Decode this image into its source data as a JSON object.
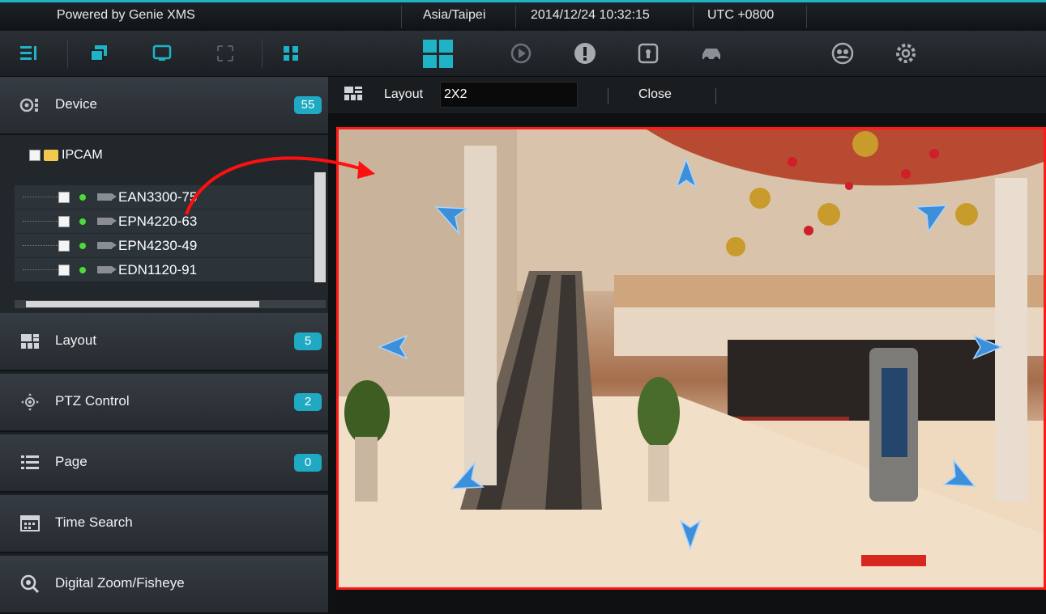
{
  "statusbar": {
    "brand": "Powered by Genie XMS",
    "timezone": "Asia/Taipei",
    "datetime": "2014/12/24 10:32:15",
    "utc": "UTC +0800"
  },
  "toolbar": {
    "left_icons": [
      "list-icon",
      "windows-icon",
      "monitor-icon",
      "fullscreen-icon",
      "split-icon"
    ],
    "center_icons": [
      "grid-layout-icon",
      "playback-icon",
      "alert-icon",
      "lock-icon",
      "car-icon",
      "group-icon",
      "settings-icon"
    ],
    "accent": "#1fb3c7"
  },
  "sidebar": {
    "device": {
      "label": "Device",
      "count": "55"
    },
    "tree": {
      "root": "IPCAM",
      "items": [
        "EAN3300-75",
        "EPN4220-63",
        "EPN4230-49",
        "EDN1120-91"
      ]
    },
    "layout": {
      "label": "Layout",
      "count": "5"
    },
    "ptz": {
      "label": "PTZ Control",
      "count": "2"
    },
    "page": {
      "label": "Page",
      "count": "0"
    },
    "time_search": {
      "label": "Time Search"
    },
    "digital_zoom": {
      "label": "Digital Zoom/Fisheye"
    }
  },
  "viewer": {
    "layout_label": "Layout",
    "layout_value": "2X2",
    "close_label": "Close",
    "highlight_color": "#ff1a1a"
  }
}
